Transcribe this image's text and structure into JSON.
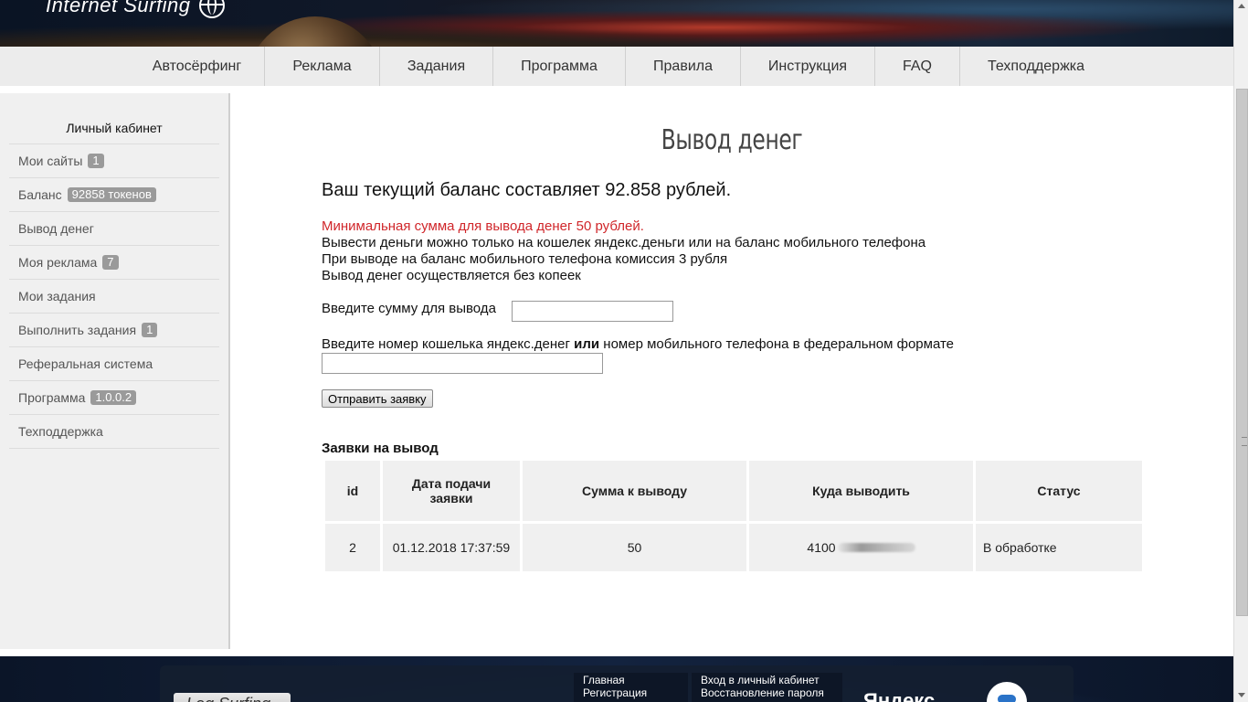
{
  "header": {
    "logo_text": "Internet Surfing",
    "logo_icon": "globe-icon"
  },
  "nav": {
    "items": [
      "Автосёрфинг",
      "Реклама",
      "Задания",
      "Программа",
      "Правила",
      "Инструкция",
      "FAQ",
      "Техподдержка"
    ]
  },
  "sidebar": {
    "title": "Личный кабинет",
    "items": [
      {
        "label": "Мои сайты",
        "badge": "1"
      },
      {
        "label": "Баланс",
        "badge": "92858 токенов"
      },
      {
        "label": "Вывод денег",
        "badge": ""
      },
      {
        "label": "Моя реклама",
        "badge": "7"
      },
      {
        "label": "Мои задания",
        "badge": ""
      },
      {
        "label": "Выполнить задания",
        "badge": "1"
      },
      {
        "label": "Реферальная система",
        "badge": ""
      },
      {
        "label": "Программа",
        "badge": "1.0.0.2"
      },
      {
        "label": "Техподдержка",
        "badge": ""
      }
    ]
  },
  "main": {
    "title": "Вывод денег",
    "balance_text": "Ваш текущий баланс составляет 92.858 рублей.",
    "notes": [
      "Минимальная сумма для вывода денег 50 рублей.",
      "Вывести деньги можно только на кошелек яндекс.деньги или на баланс мобильного телефона",
      "При выводе на баланс мобильного телефона комиссия 3 рубля",
      "Вывод денег осуществляется без копеек"
    ],
    "amount_label": "Введите сумму для вывода",
    "amount_value": "",
    "wallet_label_part1": "Введите номер кошелька яндекс.денег ",
    "wallet_label_bold": "или",
    "wallet_label_part2": " номер мобильного телефона в федеральном формате",
    "wallet_value": "",
    "submit_label": "Отправить заявку",
    "requests_title": "Заявки на вывод",
    "table": {
      "headers": [
        "id",
        "Дата подачи заявки",
        "Сумма к выводу",
        "Куда выводить",
        "Статус"
      ],
      "rows": [
        [
          "2",
          "01.12.2018 17:37:59",
          "50",
          "4100",
          "В обработке"
        ]
      ]
    }
  },
  "footer": {
    "button_label": "Log Surfing",
    "links_col1": [
      "Главная",
      "Регистрация"
    ],
    "links_col2": [
      "Вход в личный кабинет",
      "Восстановление пароля"
    ],
    "partner_text": "Яндекс"
  },
  "colors": {
    "accent_red": "#d0262a",
    "badge": "#9a9a9a"
  }
}
